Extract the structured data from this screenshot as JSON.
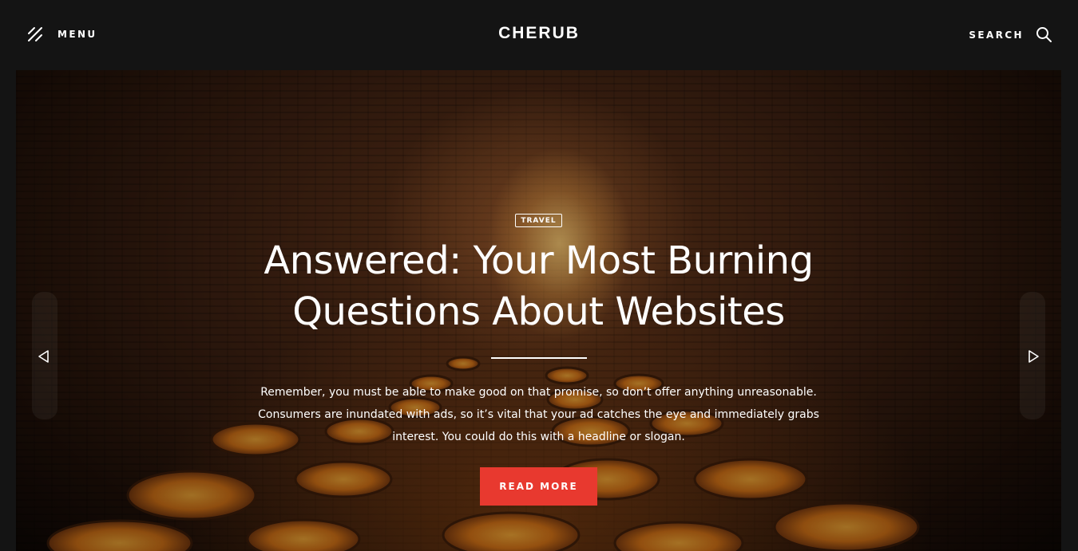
{
  "header": {
    "menu_label": "MENU",
    "logo": "CHERUB",
    "search_label": "SEARCH"
  },
  "hero": {
    "category": "TRAVEL",
    "title": "Answered: Your Most Burning Questions About Websites",
    "excerpt": "Remember, you must be able to make good on that promise, so don’t offer anything unreasonable. Consumers are inundated with ads, so it’s vital that your ad catches the eye and immediately grabs interest. You could do this with a headline or slogan.",
    "button_label": "READ MORE"
  },
  "colors": {
    "background": "#141414",
    "accent": "#e8392f",
    "text": "#ffffff"
  },
  "icons": {
    "menu": "menu-slash-icon",
    "search": "search-icon",
    "prev": "arrow-left-icon",
    "next": "arrow-right-icon"
  }
}
